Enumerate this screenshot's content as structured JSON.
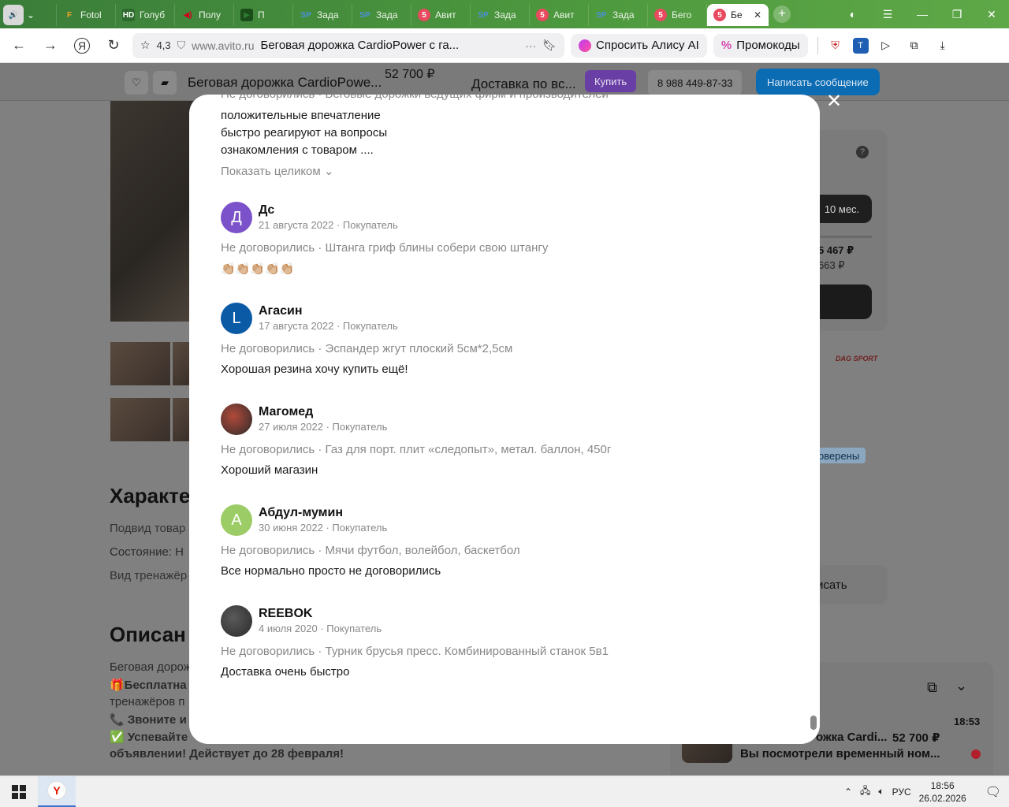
{
  "browser": {
    "tabs": [
      {
        "label": "Fotol",
        "fav": "F",
        "favColor": "#f5a623",
        "favBg": "transparent"
      },
      {
        "label": "Голуб",
        "fav": "HD",
        "favColor": "#fff",
        "favBg": "#2d6a2d"
      },
      {
        "label": "Полу",
        "fav": "◀)",
        "favColor": "#d0021b",
        "favBg": "transparent"
      },
      {
        "label": "П",
        "fav": "▶",
        "favColor": "#2e7d32",
        "favBg": "#1b4d1b"
      },
      {
        "label": "Зада",
        "fav": "SP",
        "favColor": "#4a90d9",
        "favBg": "transparent"
      },
      {
        "label": "Зада",
        "fav": "SP",
        "favColor": "#4a90d9",
        "favBg": "transparent"
      },
      {
        "label": "Авит",
        "fav": "5",
        "favColor": "#fff",
        "favBg": "#e84a5f"
      },
      {
        "label": "Зада",
        "fav": "SP",
        "favColor": "#4a90d9",
        "favBg": "transparent"
      },
      {
        "label": "Авит",
        "fav": "5",
        "favColor": "#fff",
        "favBg": "#e84a5f"
      },
      {
        "label": "Зада",
        "fav": "SP",
        "favColor": "#4a90d9",
        "favBg": "transparent"
      },
      {
        "label": "Бего",
        "fav": "5",
        "favColor": "#fff",
        "favBg": "#e84a5f"
      },
      {
        "label": "Бе",
        "fav": "5",
        "favColor": "#fff",
        "favBg": "#e84a5f",
        "active": true
      }
    ],
    "rating": "4,3",
    "host": "www.avito.ru",
    "page_title": "Беговая дорожка CardioPower с га...",
    "alice_label": "Спросить Алису AI",
    "promo_label": "Промокоды"
  },
  "listing": {
    "title": "Беговая дорожка CardioPowe...",
    "price": "52 700 ₽",
    "delivery": "Доставка по вс...",
    "buy_label": "Купить",
    "phone": "8 988 449-87-33",
    "message_label": "Написать сообщение",
    "section_characteristics": "Характе",
    "char_lines": [
      "Подвид товар",
      "Состояние: Н",
      "Вид тренажёр"
    ],
    "section_description": "Описан",
    "desc_lines": [
      "Беговая дорож",
      "🎁Бесплатна",
      "тренажёров п",
      "📞 Звоните и",
      "✅ Успевайте"
    ],
    "desc_last": "объявлении! Действует до 28 февраля!",
    "installment_label": "10 мес.",
    "installment_price_1": "5 467 ₽",
    "installment_price_2": "663 ₽",
    "brand": "DAG SPORT",
    "verified_label": "оверены",
    "write_label": "исать"
  },
  "chat": {
    "time": "18:53",
    "title": "ожка Cardi...",
    "price": "52 700 ₽",
    "subtitle": "Вы посмотрели временный ном..."
  },
  "modal": {
    "cut_top": "Не договорились · Беговые дорожки ведущих фирм и производителей",
    "prev_lines": [
      "положительные впечатление",
      "быстро реагируют на вопросы",
      "ознакомления с товаром ...."
    ],
    "show_all": "Показать целиком ⌄",
    "reviews": [
      {
        "initial": "Д",
        "color": "#7b52c9",
        "name": "Дс",
        "date": "21 августа 2022 · Покупатель",
        "deal": "Не договорились · Штанга гриф блины собери свою штангу",
        "text": "👏🏼👏🏼👏🏼👏🏼👏🏼"
      },
      {
        "initial": "L",
        "color": "#0b5aa6",
        "name": "Агасин",
        "date": "17 августа 2022 · Покупатель",
        "deal": "Не договорились · Эспандер жгут плоский 5см*2,5см",
        "text": "Хорошая резина хочу купить ещё!"
      },
      {
        "initial": "",
        "color": "#b24a3a",
        "name": "Магомед",
        "date": "27 июля 2022 · Покупатель",
        "deal": "Не договорились · Газ для порт. плит «следопыт», метал. баллон, 450г",
        "text": "Хороший магазин"
      },
      {
        "initial": "А",
        "color": "#9ccc65",
        "name": "Абдул-мумин",
        "date": "30 июня 2022 · Покупатель",
        "deal": "Не договорились · Мячи футбол, волейбол, баскетбол",
        "text": "Все нормально просто не договорились"
      },
      {
        "initial": "",
        "color": "#5a5a5a",
        "name": "REEBOK",
        "date": "4 июля 2020 · Покупатель",
        "deal": "Не договорились · Турник брусья пресс. Комбинированный станок 5в1",
        "text": "Доставка очень быстро"
      }
    ]
  },
  "taskbar": {
    "lang": "РУС",
    "time": "18:56",
    "date": "26.02.2026"
  }
}
